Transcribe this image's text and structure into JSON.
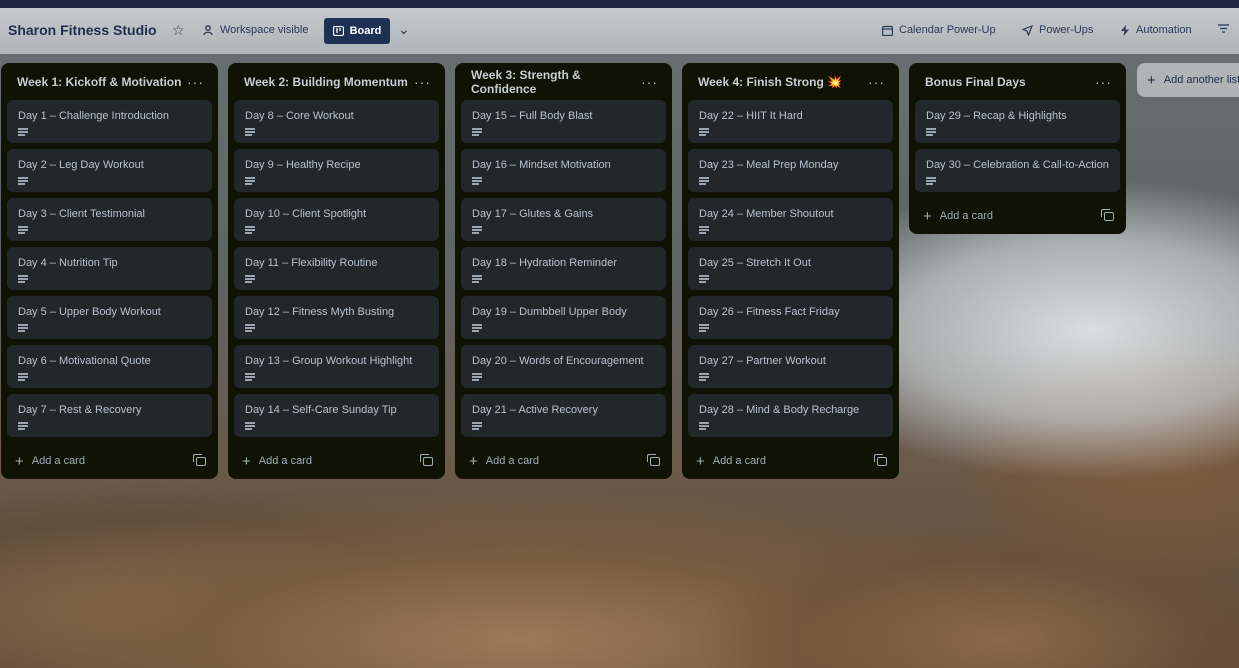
{
  "header": {
    "board_title": "Sharon Fitness Studio",
    "workspace_visible": "Workspace visible",
    "board_view": "Board",
    "calendar_powerup": "Calendar Power-Up",
    "powerups": "Power-Ups",
    "automation": "Automation"
  },
  "lists": [
    {
      "title": "Week 1: Kickoff & Motivation",
      "cards": [
        "Day 1 – Challenge Introduction",
        "Day 2 – Leg Day Workout",
        "Day 3 – Client Testimonial",
        "Day 4 – Nutrition Tip",
        "Day 5 – Upper Body Workout",
        "Day 6 – Motivational Quote",
        "Day 7 – Rest & Recovery"
      ],
      "add_card": "Add a card"
    },
    {
      "title": "Week 2: Building Momentum",
      "cards": [
        "Day 8 – Core Workout",
        "Day 9 – Healthy Recipe",
        "Day 10 – Client Spotlight",
        "Day 11 – Flexibility Routine",
        "Day 12 – Fitness Myth Busting",
        "Day 13 – Group Workout Highlight",
        "Day 14 – Self-Care Sunday Tip"
      ],
      "add_card": "Add a card"
    },
    {
      "title": "Week 3: Strength & Confidence",
      "cards": [
        "Day 15 – Full Body Blast",
        "Day 16 – Mindset Motivation",
        "Day 17 – Glutes & Gains",
        "Day 18 – Hydration Reminder",
        "Day 19 – Dumbbell Upper Body",
        "Day 20 – Words of Encouragement",
        "Day 21 – Active Recovery"
      ],
      "add_card": "Add a card"
    },
    {
      "title": "Week 4: Finish Strong 💥",
      "cards": [
        "Day 22 – HIIT It Hard",
        "Day 23 – Meal Prep Monday",
        "Day 24 – Member Shoutout",
        "Day 25 – Stretch It Out",
        "Day 26 – Fitness Fact Friday",
        "Day 27 – Partner Workout",
        "Day 28 – Mind & Body Recharge"
      ],
      "add_card": "Add a card"
    },
    {
      "title": "Bonus Final Days",
      "cards": [
        "Day 29 – Recap & Highlights",
        "Day 30 – Celebration & Call-to-Action"
      ],
      "add_card": "Add a card"
    }
  ],
  "add_list": "Add another list"
}
